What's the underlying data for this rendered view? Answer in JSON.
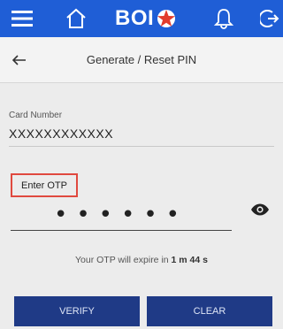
{
  "app": {
    "brand": "BOI",
    "brand_color": "#1f5ed6",
    "star_color": "#e23b2c"
  },
  "topbar": {
    "icons": [
      "menu-icon",
      "home-icon",
      "bell-icon",
      "logout-icon"
    ]
  },
  "header": {
    "title": "Generate / Reset PIN",
    "back_icon": "arrow-left-icon"
  },
  "card": {
    "label": "Card Number",
    "value": "XXXXXXXXXXXX"
  },
  "otp": {
    "label": "Enter OTP",
    "masked_value": "••••••",
    "eye_icon": "eye-icon",
    "timer_prefix": "Your OTP will expire in ",
    "timer_value": "1 m 44 s"
  },
  "buttons": {
    "verify": "VERIFY",
    "clear": "CLEAR",
    "color": "#1f3a86"
  }
}
